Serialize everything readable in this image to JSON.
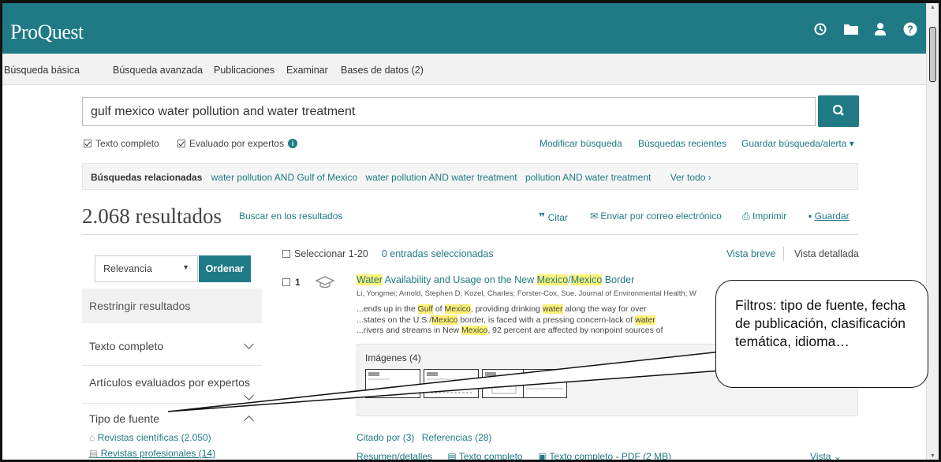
{
  "app": {
    "logo": "ProQuest",
    "brand_color": "#1f7a86"
  },
  "header": {
    "icons": [
      "history-icon",
      "folder-icon",
      "user-icon",
      "help-icon"
    ]
  },
  "nav": {
    "items": [
      "Búsqueda básica",
      "Búsqueda avanzada",
      "Publicaciones",
      "Examinar",
      "Bases de datos (2)"
    ]
  },
  "search": {
    "query": "gulf mexico water pollution and water treatment",
    "button_icon": "search-icon"
  },
  "options": {
    "full_text": "Texto completo",
    "peer_reviewed": "Evaluado por expertos",
    "modify": "Modificar búsqueda",
    "recent": "Búsquedas recientes",
    "save_alert": "Guardar búsqueda/alerta ▾"
  },
  "related": {
    "label": "Búsquedas relacionadas",
    "items": [
      "water pollution AND Gulf of Mexico",
      "water pollution AND water treatment",
      "pollution AND water treatment"
    ],
    "see_all": "Ver todo ›"
  },
  "results": {
    "count": "2.068 resultados",
    "search_within": "Buscar en los resultados",
    "cite": "Citar",
    "email": "Enviar por correo electrónico",
    "print": "Imprimir",
    "save": "Guardar"
  },
  "sidebar": {
    "sort_value": "Relevancia",
    "sort_button": "Ordenar",
    "restrict": "Restringir resultados",
    "facets": [
      "Texto completo",
      "Artículos evaluados por expertos",
      "Tipo de fuente"
    ],
    "source_types": [
      "Revistas científicas (2.050)",
      "Revistas profesionales (14)"
    ]
  },
  "list": {
    "select_label": "Seleccionar 1-20",
    "selected": "0 entradas seleccionadas",
    "view_brief": "Vista breve",
    "view_detailed": "Vista detallada"
  },
  "result1": {
    "number": "1",
    "title_parts": [
      "Water",
      " Availability and Usage on the New ",
      "Mexico",
      "/",
      "Mexico",
      " Border"
    ],
    "authors": "Li, Yongmei; Arnold, Stephen D; Kozel, Charles; Forster-Cox, Sue. Journal of Environmental Health; W",
    "snippet1_parts": [
      "...ends up in the ",
      "Gulf",
      " of ",
      "Mexico",
      ", providing drinking ",
      "water",
      " along the way for over"
    ],
    "snippet2_parts": [
      "...states on the U.S./",
      "Mexico",
      " border, is faced with a pressing concern-lack of ",
      "water"
    ],
    "snippet3_parts": [
      "...rivers and streams in New ",
      "Mexico",
      ", 92 percent are affected by nonpoint sources of"
    ],
    "images_label": "Imágenes (4)",
    "cited_by": "Citado por (3)",
    "references": "Referencias (28)",
    "abstract": "Resumen/detalles",
    "full_text": "Texto completo",
    "pdf": "Texto completo - PDF (2 MB)",
    "view": "Vista ⌄"
  },
  "callout": {
    "text": "Filtros: tipo de fuente, fecha de publicación, clasificación temática, idioma…"
  }
}
